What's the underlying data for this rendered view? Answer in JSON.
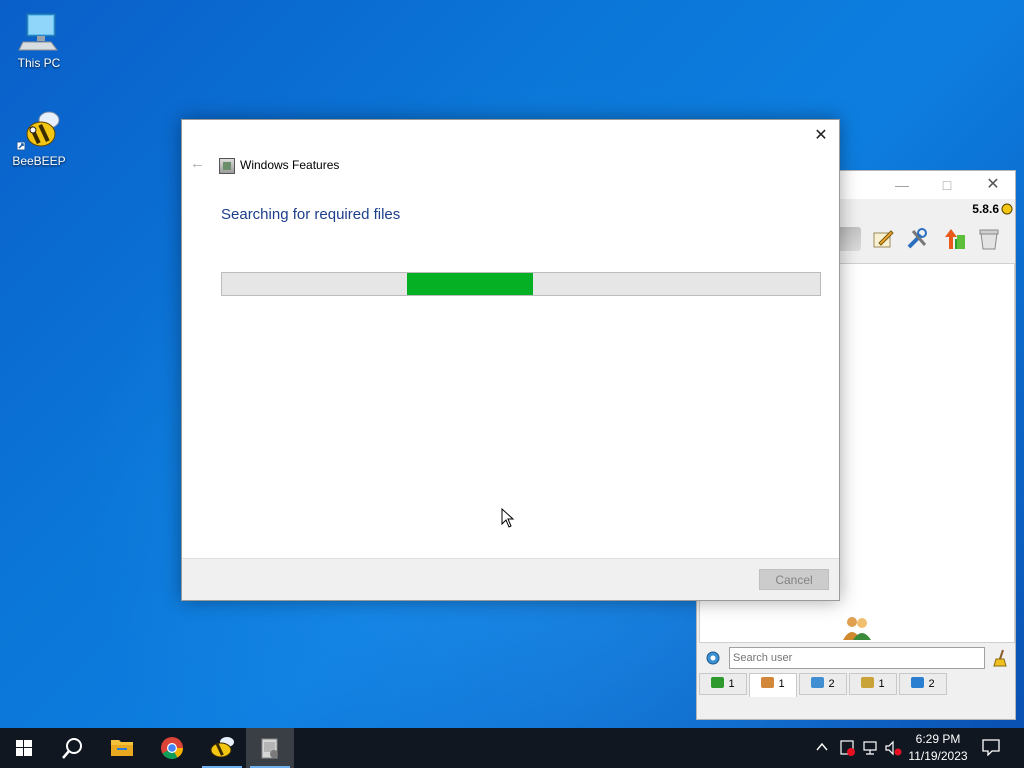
{
  "desktop": {
    "icons": [
      {
        "label": "This PC",
        "icon": "this-pc-icon"
      },
      {
        "label": "BeeBEEP",
        "icon": "beebeep-icon"
      }
    ]
  },
  "beebeep": {
    "version": "5.8.6",
    "search_placeholder": "Search user",
    "tabs": [
      {
        "count": "1",
        "icon": "chat-window-icon",
        "color": "#2e9a2e"
      },
      {
        "count": "1",
        "icon": "users-icon",
        "color": "#d2873a"
      },
      {
        "count": "2",
        "icon": "chats-icon",
        "color": "#3f8fd2"
      },
      {
        "count": "1",
        "icon": "groups-icon",
        "color": "#c9a238"
      },
      {
        "count": "2",
        "icon": "shares-icon",
        "color": "#2b7fd0"
      }
    ]
  },
  "dialog": {
    "title": "Windows Features",
    "heading": "Searching for required files",
    "progress_start": 0.31,
    "progress_end": 0.52,
    "cancel_label": "Cancel",
    "progress_color": "#06b025"
  },
  "taskbar": {
    "apps": [
      {
        "icon": "start-windows-icon"
      },
      {
        "icon": "search-icon"
      },
      {
        "icon": "file-explorer-icon"
      },
      {
        "icon": "chrome-icon"
      },
      {
        "icon": "beebeep-taskbar-icon"
      },
      {
        "icon": "windows-features-taskbar-icon"
      }
    ],
    "time": "6:29 PM",
    "date": "11/19/2023"
  }
}
